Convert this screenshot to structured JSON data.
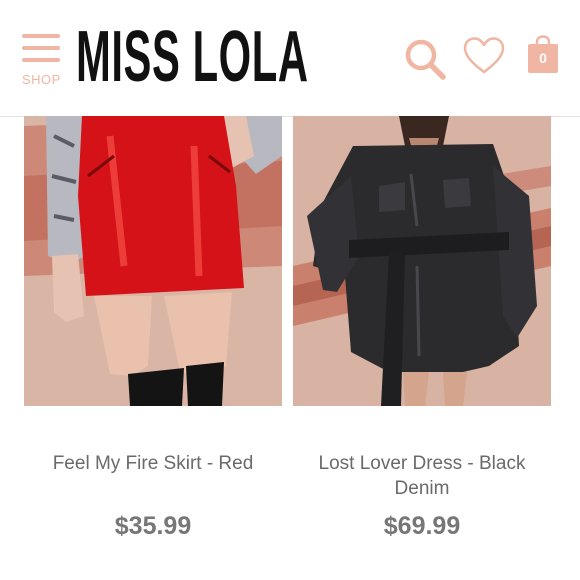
{
  "header": {
    "menu_label": "SHOP",
    "logo": "MISS LOLA",
    "cart_count": "0",
    "accent_color": "#f0b6a3",
    "icons": [
      "hamburger-menu-icon",
      "search-icon",
      "heart-icon",
      "shopping-bag-icon"
    ]
  },
  "products": [
    {
      "name": "Feel My Fire Skirt - Red",
      "price": "$35.99"
    },
    {
      "name": "Lost Lover Dress - Black Denim",
      "price": "$69.99"
    }
  ]
}
